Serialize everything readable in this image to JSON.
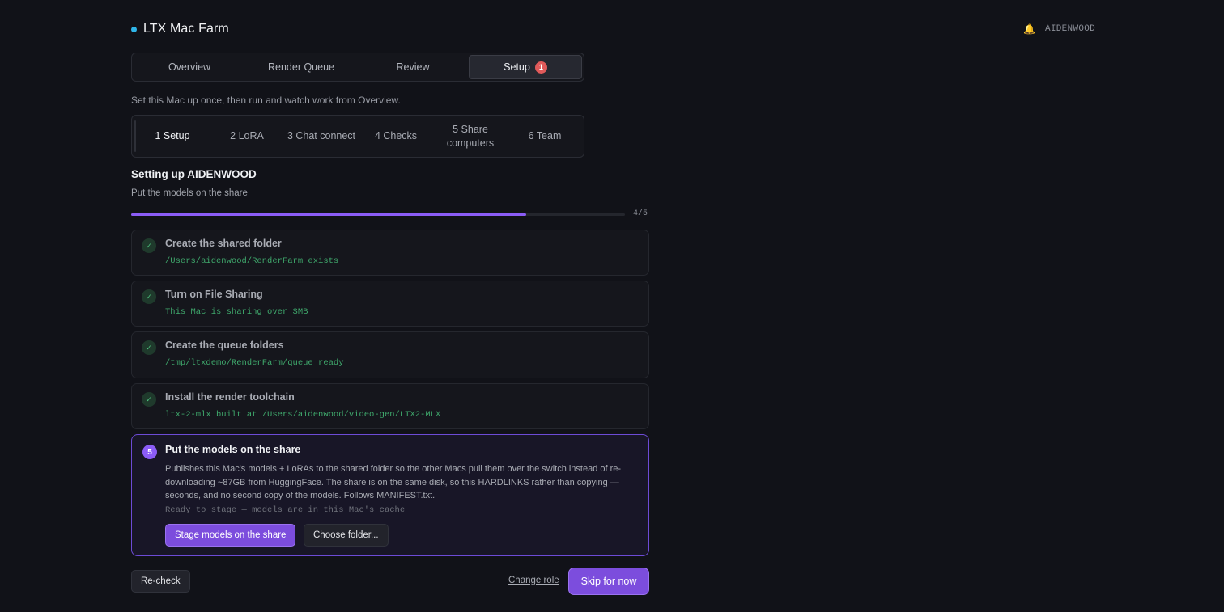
{
  "app": {
    "title": "LTX Mac Farm",
    "status_color": "#2fb5e8"
  },
  "user": {
    "name": "AIDENWOOD",
    "icon": "bell-icon"
  },
  "main_tabs": [
    {
      "label": "Overview"
    },
    {
      "label": "Render Queue"
    },
    {
      "label": "Review"
    },
    {
      "label": "Setup",
      "badge": "1",
      "active": true
    }
  ],
  "intro": "Set this Mac up once, then run and watch work from Overview.",
  "step_tabs": [
    {
      "label": "1 Setup",
      "active": true
    },
    {
      "label": "2 LoRA"
    },
    {
      "label": "3 Chat connect"
    },
    {
      "label": "4 Checks"
    },
    {
      "label": "5 Share computers"
    },
    {
      "label": "6 Team"
    }
  ],
  "section": {
    "title": "Setting up AIDENWOOD",
    "subtitle": "Put the models on the share"
  },
  "progress": {
    "completed": 4,
    "total": 5,
    "label": "4/5"
  },
  "steps": [
    {
      "title": "Create the shared folder",
      "detail": "/Users/aidenwood/RenderFarm exists",
      "done": true
    },
    {
      "title": "Turn on File Sharing",
      "detail": "This Mac is sharing over SMB",
      "done": true
    },
    {
      "title": "Create the queue folders",
      "detail": "/tmp/ltxdemo/RenderFarm/queue ready",
      "done": true
    },
    {
      "title": "Install the render toolchain",
      "detail": "ltx-2-mlx built at /Users/aidenwood/video-gen/LTX2-MLX",
      "done": true
    }
  ],
  "active_step": {
    "number": "5",
    "title": "Put the models on the share",
    "description": "Publishes this Mac's models + LoRAs to the shared folder so the other Macs pull them over the switch instead of re-downloading ~87GB from HuggingFace. The share is on the same disk, so this HARDLINKS rather than copying — seconds, and no second copy of the models. Follows MANIFEST.txt.",
    "status": "Ready to stage — models are in this Mac's cache",
    "primary_button": "Stage models on the share",
    "secondary_button": "Choose folder..."
  },
  "footer": {
    "recheck_label": "Re-check",
    "change_role_label": "Change role",
    "skip_label": "Skip for now"
  },
  "colors": {
    "accent": "#8b5cf6",
    "success": "#3fa86c",
    "badge": "#e05a5a"
  }
}
